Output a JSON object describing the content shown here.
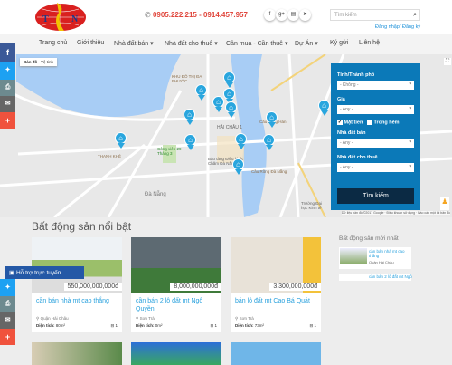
{
  "header": {
    "logo_text": "TN",
    "phone": "0905.222.215 - 0914.457.957",
    "social": [
      "f",
      "g+",
      "rss",
      "tw"
    ],
    "search_placeholder": "Tìm kiếm",
    "login": "Đăng nhập/ Đăng ký"
  },
  "nav": [
    "Trang chủ",
    "Giới thiệu",
    "Nhà đất bán",
    "Nhà đất cho thuê",
    "Cần mua - Cần thuê",
    "Dự Án",
    "Ký gửi",
    "Liên hệ"
  ],
  "map": {
    "type_map": "Bản đồ",
    "type_sat": "Vệ tinh",
    "labels": [
      "KHU ĐÔ THỊ ĐA PHƯỚC",
      "HẢI CHÂU 1",
      "Cầu Sông Hàn",
      "Cầu Rồng Đà Nẵng",
      "Bảo tàng Điêu khắc Chăm Đà Nẵng",
      "Công viên 29 Tháng 3",
      "THANH KHÊ",
      "Đà Nẵng",
      "Trường Đại học Kinh tế"
    ],
    "credit": "Dữ liệu bản đồ ©2017 Google · Điều khoản sử dụng · Báo cáo một lỗi bản đồ"
  },
  "search_panel": {
    "province_label": "Tỉnh/Thành phố",
    "province_value": "- Không -",
    "price_label": "Giá",
    "price_value": "- Any -",
    "front_label": "Mặt tiền",
    "front_checked": true,
    "alley_label": "Trong hẻm",
    "alley_checked": false,
    "sale_label": "Nhà đất bán",
    "sale_value": "- Any -",
    "rent_label": "Nhà đất cho thuê",
    "rent_value": "- Any -",
    "button": "Tìm kiếm"
  },
  "featured": {
    "title": "Bất động sản nổi bật",
    "area_label": "Diện tích:",
    "cards": [
      {
        "price": "550,000,000,000đ",
        "title": "cần bán nhà mt cao thắng",
        "location": "Quận Hải Châu",
        "area": "80m²",
        "rooms": "1"
      },
      {
        "price": "8,000,000,000đ",
        "title": "cần bán 2 lô đất mt Ngô Quyền",
        "location": "Sơn Trà",
        "area": "0m²",
        "rooms": "1"
      },
      {
        "price": "3,300,000,000đ",
        "title": "bán lô đất mt Cao Bá Quát",
        "location": "Sơn Trà",
        "area": "73m²",
        "rooms": "1"
      }
    ]
  },
  "latest": {
    "title": "Bất động sản mới nhất",
    "items": [
      {
        "title": "cần bán nhà mt cao thắng",
        "location": "Quận Hải Châu"
      },
      {
        "title": "cần bán 2 lô đất mt Ngô"
      }
    ]
  },
  "support": "Hỗ trợ trực tuyến",
  "colors": {
    "accent": "#29a8e0",
    "panel": "#0b79b8",
    "phone": "#e0463c"
  }
}
